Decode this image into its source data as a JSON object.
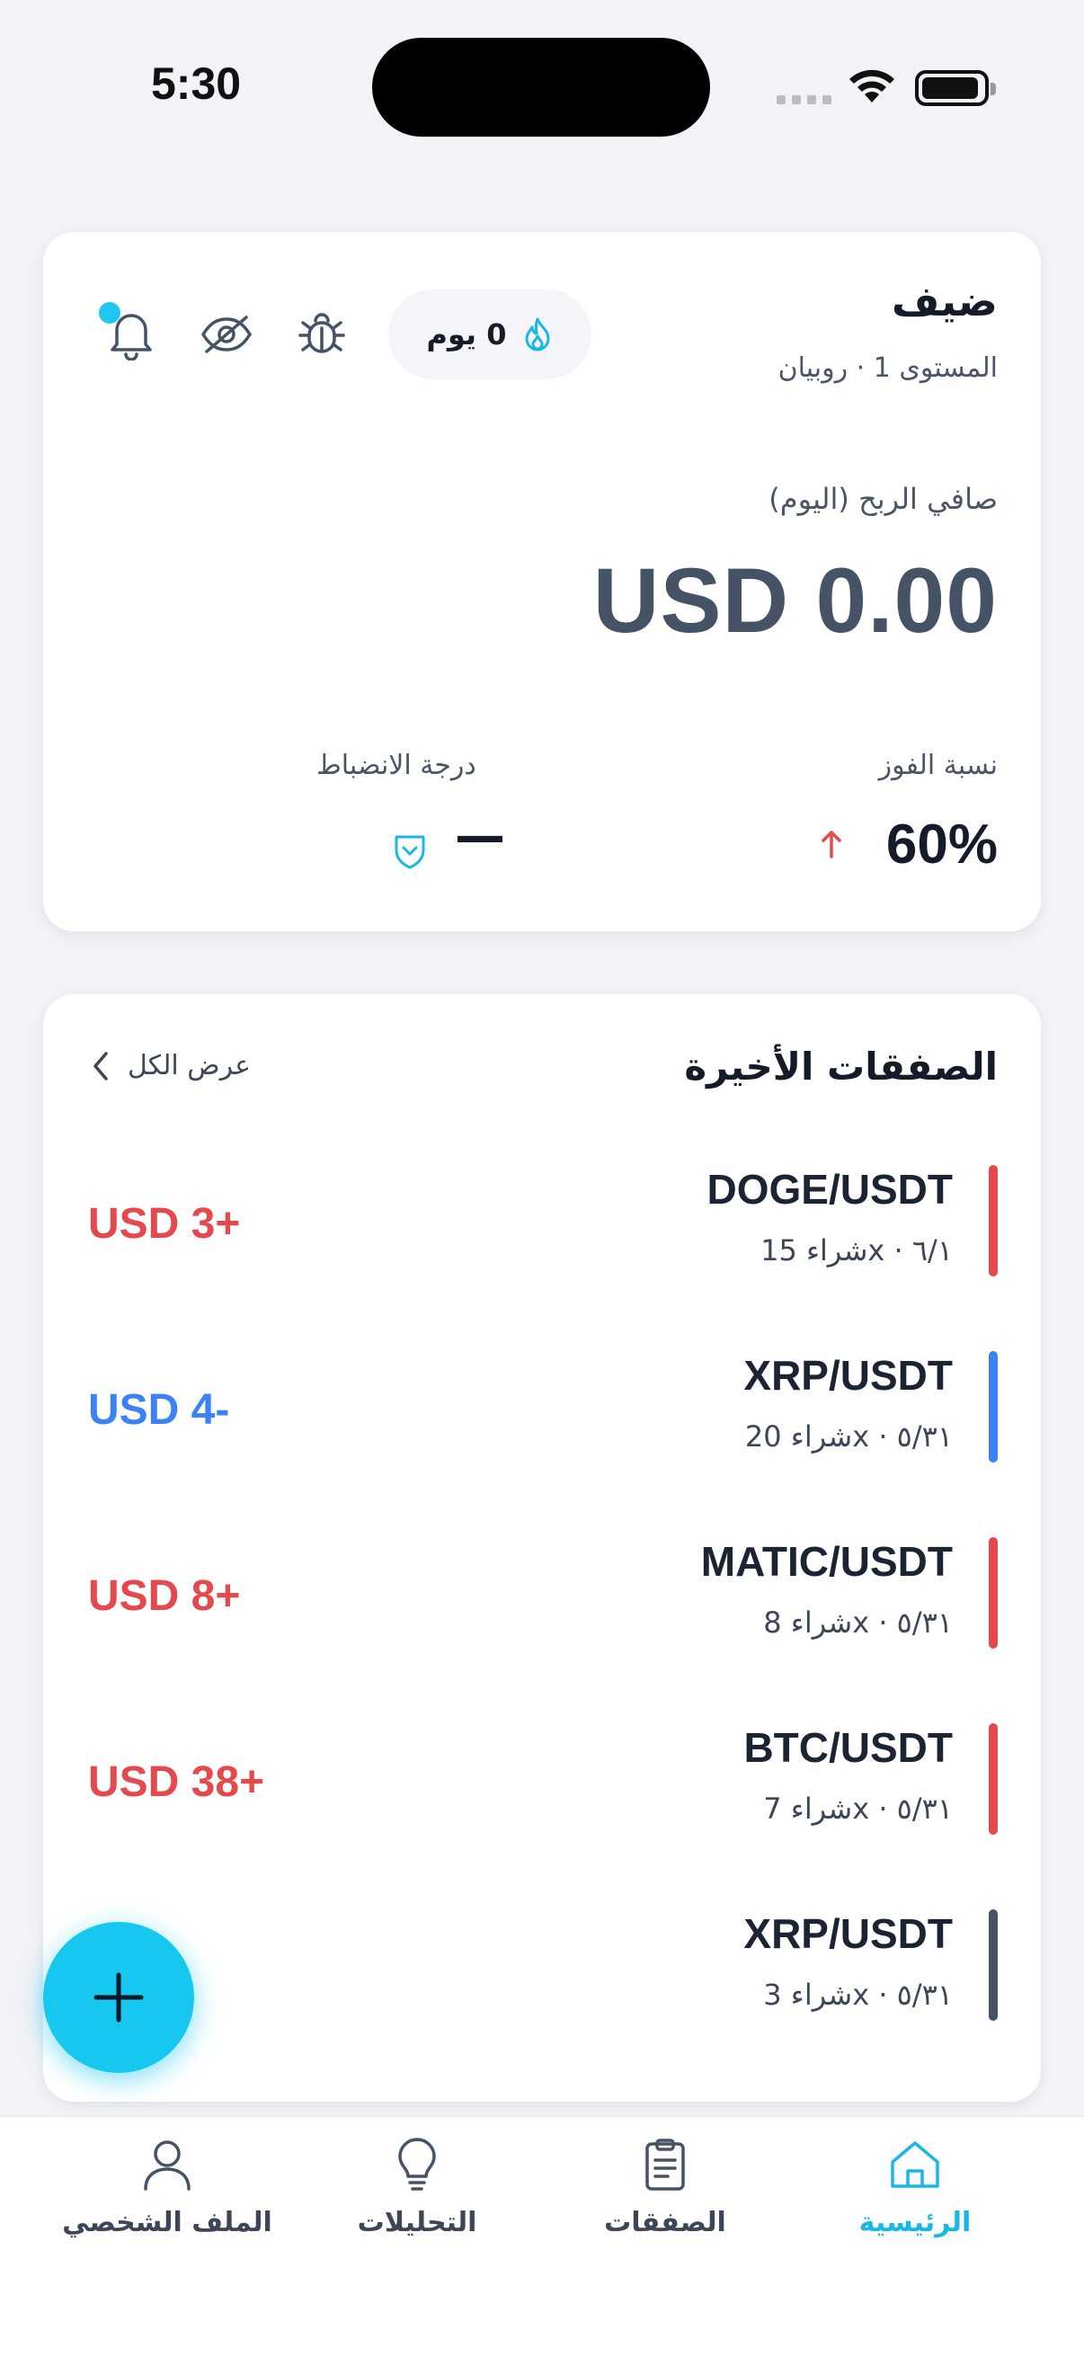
{
  "status_bar": {
    "time": "5:30"
  },
  "colors": {
    "accent": "#17b8e6",
    "profit": "#e5484d",
    "loss": "#3b82f6",
    "neutral_bar": "#465266"
  },
  "profile": {
    "name": "ضيف",
    "level": "المستوى 1 · روبيان",
    "streak": "0 يوم",
    "icons": [
      "fire-icon",
      "bug-icon",
      "eye-off-icon",
      "bell-icon"
    ]
  },
  "summary": {
    "profit_label": "صافي الربح (اليوم)",
    "profit_value": "USD 0.00",
    "win_rate_label": "نسبة الفوز",
    "win_rate_value": "60%",
    "discipline_label": "درجة الانضباط",
    "discipline_value": "—"
  },
  "trades": {
    "title": "الصفقات الأخيرة",
    "view_all": "عرض الكل",
    "items": [
      {
        "pair": "DOGE/USDT",
        "meta": "شراء 15x · ٦/١",
        "pnl": "USD 3+",
        "status": "profit"
      },
      {
        "pair": "XRP/USDT",
        "meta": "شراء 20x · ٥/٣١",
        "pnl": "USD 4-",
        "status": "loss"
      },
      {
        "pair": "MATIC/USDT",
        "meta": "شراء 8x · ٥/٣١",
        "pnl": "USD 8+",
        "status": "profit"
      },
      {
        "pair": "BTC/USDT",
        "meta": "شراء 7x · ٥/٣١",
        "pnl": "USD 38+",
        "status": "profit"
      },
      {
        "pair": "XRP/USDT",
        "meta": "شراء 3x · ٥/٣١",
        "pnl": "",
        "status": "neutral"
      }
    ]
  },
  "tabbar": {
    "home": "الرئيسية",
    "trades": "الصفقات",
    "analytics": "التحليلات",
    "profile": "الملف الشخصي",
    "active": "home"
  }
}
